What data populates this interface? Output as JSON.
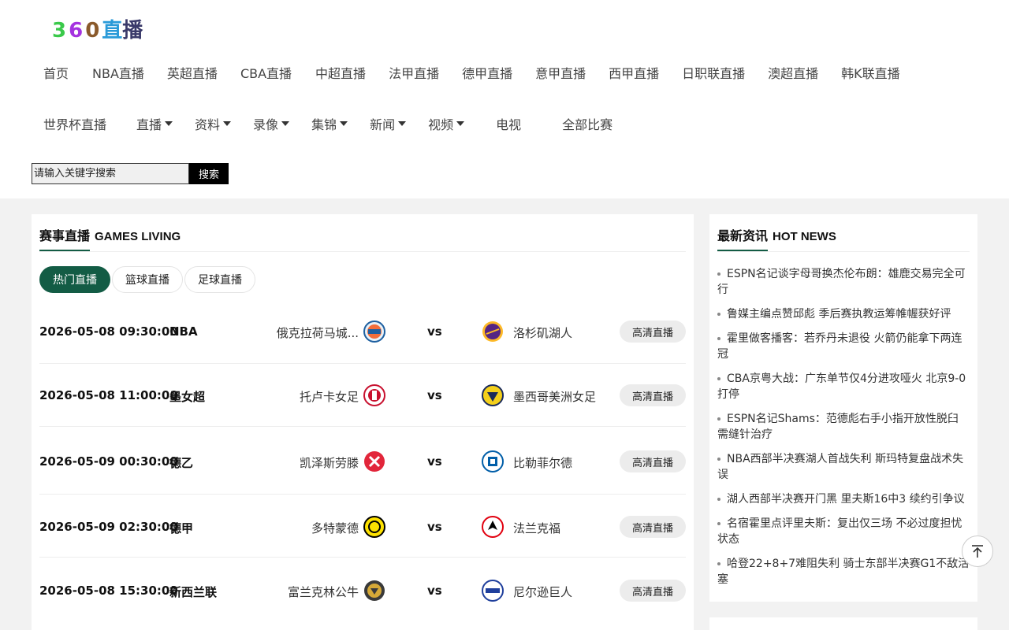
{
  "logo": {
    "d1": "3",
    "d2": "6",
    "d3": "0",
    "cn1": "直",
    "cn2": "播"
  },
  "nav": {
    "row1": [
      "首页",
      "NBA直播",
      "英超直播",
      "CBA直播",
      "中超直播",
      "法甲直播",
      "德甲直播",
      "意甲直播",
      "西甲直播",
      "日职联直播",
      "澳超直播",
      "韩K联直播"
    ],
    "row2": [
      {
        "label": "世界杯直播",
        "dropdown": false
      },
      {
        "label": "直播",
        "dropdown": true
      },
      {
        "label": "资料",
        "dropdown": true
      },
      {
        "label": "录像",
        "dropdown": true
      },
      {
        "label": "集锦",
        "dropdown": true
      },
      {
        "label": "新闻",
        "dropdown": true
      },
      {
        "label": "视频",
        "dropdown": true
      },
      {
        "label": "电视",
        "dropdown": false
      },
      {
        "label": "全部比赛",
        "dropdown": false
      }
    ]
  },
  "search": {
    "placeholder": "请输入关键字搜索",
    "button": "搜索"
  },
  "games": {
    "title_cn": "赛事直播",
    "title_en": "GAMES LIVING",
    "tabs": [
      "热门直播",
      "篮球直播",
      "足球直播"
    ],
    "active_tab": 0,
    "matches": [
      {
        "time": "2026-05-08 09:30:00",
        "league": "NBA",
        "home": "俄克拉荷马城...",
        "home_icon": "okc-logo",
        "away": "洛杉矶湖人",
        "away_icon": "lakers-logo",
        "button": "高清直播"
      },
      {
        "time": "2026-05-08 11:00:00",
        "league": "墨女超",
        "home": "托卢卡女足",
        "home_icon": "toluca-logo",
        "away": "墨西哥美洲女足",
        "away_icon": "america-logo",
        "button": "高清直播"
      },
      {
        "time": "2026-05-09 00:30:00",
        "league": "德乙",
        "home": "凯泽斯劳滕",
        "home_icon": "kaiserslautern-logo",
        "away": "比勒菲尔德",
        "away_icon": "bielefeld-logo",
        "button": "高清直播"
      },
      {
        "time": "2026-05-09 02:30:00",
        "league": "德甲",
        "home": "多特蒙德",
        "home_icon": "dortmund-logo",
        "away": "法兰克福",
        "away_icon": "frankfurt-logo",
        "button": "高清直播"
      },
      {
        "time": "2026-05-08 15:30:00",
        "league": "新西兰联",
        "home": "富兰克林公牛",
        "home_icon": "bulls-logo",
        "away": "尼尔逊巨人",
        "away_icon": "giants-logo",
        "button": "高清直播"
      }
    ],
    "vs_label": "vs"
  },
  "news": {
    "title_cn": "最新资讯",
    "title_en": "HOT NEWS",
    "items": [
      "ESPN名记谈字母哥换杰伦布朗：雄鹿交易完全可行",
      "鲁媒主编点赞邱彪 季后赛执教运筹帷幄获好评",
      "霍里做客播客：若乔丹未退役 火箭仍能拿下两连冠",
      "CBA京粤大战：广东单节仅4分进攻哑火 北京9-0打停",
      "ESPN名记Shams：范德彪右手小指开放性脱臼 需缝针治疗",
      "NBA西部半决赛湖人首战失利 斯玛特复盘战术失误",
      "湖人西部半决赛开门黑 里夫斯16中3 续约引争议",
      "名宿霍里点评里夫斯：复出仅三场 不必过度担忧状态",
      "哈登22+8+7难阻失利 骑士东部半决赛G1不敌活塞"
    ]
  },
  "colors": {
    "accent": "#135c45",
    "search_button": "#000000"
  },
  "icons": {
    "back_to_top": "arrow-up-icon"
  }
}
